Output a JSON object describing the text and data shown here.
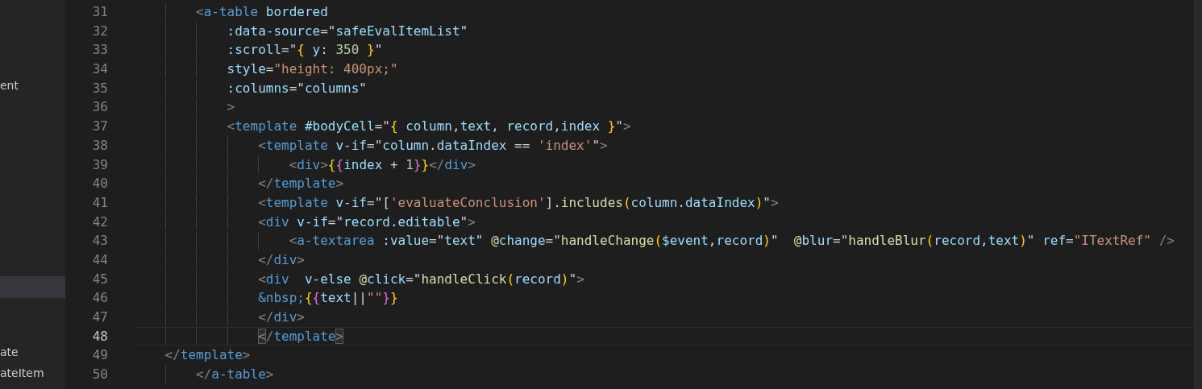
{
  "sidebar": {
    "items": [
      {
        "label": "ent",
        "selected": false
      },
      {
        "selected": true
      },
      {
        "label": "ate",
        "selected": false
      },
      {
        "label": "ateItem",
        "selected": false
      }
    ]
  },
  "editor": {
    "lines": [
      {
        "number": "31",
        "current": false,
        "tokens": [
          {
            "kind": "punct",
            "text": "        <"
          },
          {
            "kind": "tag",
            "text": "a-table"
          },
          {
            "kind": "attr",
            "text": " bordered"
          }
        ]
      },
      {
        "number": "32",
        "current": false,
        "tokens": [
          {
            "kind": "attr",
            "text": "            :data-source"
          },
          {
            "kind": "plain",
            "text": "=\""
          },
          {
            "kind": "var",
            "text": "safeEvalItemList"
          },
          {
            "kind": "plain",
            "text": "\""
          }
        ]
      },
      {
        "number": "33",
        "current": false,
        "tokens": [
          {
            "kind": "attr",
            "text": "            :scroll"
          },
          {
            "kind": "plain",
            "text": "=\""
          },
          {
            "kind": "brace1",
            "text": "{"
          },
          {
            "kind": "var",
            "text": " y"
          },
          {
            "kind": "plain",
            "text": ": "
          },
          {
            "kind": "number",
            "text": "350"
          },
          {
            "kind": "brace1",
            "text": " }"
          },
          {
            "kind": "plain",
            "text": "\""
          }
        ]
      },
      {
        "number": "34",
        "current": false,
        "tokens": [
          {
            "kind": "attr",
            "text": "            style"
          },
          {
            "kind": "plain",
            "text": "="
          },
          {
            "kind": "string",
            "text": "\"height: 400px;\""
          }
        ]
      },
      {
        "number": "35",
        "current": false,
        "tokens": [
          {
            "kind": "attr",
            "text": "            :columns"
          },
          {
            "kind": "plain",
            "text": "=\""
          },
          {
            "kind": "var",
            "text": "columns"
          },
          {
            "kind": "plain",
            "text": "\""
          }
        ]
      },
      {
        "number": "36",
        "current": false,
        "tokens": [
          {
            "kind": "punct",
            "text": "            >"
          }
        ]
      },
      {
        "number": "37",
        "current": false,
        "tokens": [
          {
            "kind": "punct",
            "text": "            <"
          },
          {
            "kind": "tag",
            "text": "template"
          },
          {
            "kind": "attr",
            "text": " #bodyCell"
          },
          {
            "kind": "plain",
            "text": "=\""
          },
          {
            "kind": "brace1",
            "text": "{"
          },
          {
            "kind": "var",
            "text": " column"
          },
          {
            "kind": "plain",
            "text": ","
          },
          {
            "kind": "var",
            "text": "text"
          },
          {
            "kind": "plain",
            "text": ", "
          },
          {
            "kind": "var",
            "text": "record"
          },
          {
            "kind": "plain",
            "text": ","
          },
          {
            "kind": "var",
            "text": "index"
          },
          {
            "kind": "brace1",
            "text": " }"
          },
          {
            "kind": "plain",
            "text": "\""
          },
          {
            "kind": "punct",
            "text": ">"
          }
        ]
      },
      {
        "number": "38",
        "current": false,
        "tokens": [
          {
            "kind": "punct",
            "text": "                <"
          },
          {
            "kind": "tag",
            "text": "template"
          },
          {
            "kind": "attr",
            "text": " v-if"
          },
          {
            "kind": "plain",
            "text": "=\""
          },
          {
            "kind": "var",
            "text": "column"
          },
          {
            "kind": "plain",
            "text": "."
          },
          {
            "kind": "var",
            "text": "dataIndex"
          },
          {
            "kind": "plain",
            "text": " == "
          },
          {
            "kind": "string",
            "text": "'index'"
          },
          {
            "kind": "plain",
            "text": "\""
          },
          {
            "kind": "punct",
            "text": ">"
          }
        ]
      },
      {
        "number": "39",
        "current": false,
        "tokens": [
          {
            "kind": "punct",
            "text": "                    <"
          },
          {
            "kind": "tag",
            "text": "div"
          },
          {
            "kind": "punct",
            "text": ">"
          },
          {
            "kind": "brace1",
            "text": "{"
          },
          {
            "kind": "brace2",
            "text": "{"
          },
          {
            "kind": "var",
            "text": "index"
          },
          {
            "kind": "plain",
            "text": " + "
          },
          {
            "kind": "number",
            "text": "1"
          },
          {
            "kind": "brace2",
            "text": "}"
          },
          {
            "kind": "brace1",
            "text": "}"
          },
          {
            "kind": "punct",
            "text": "</"
          },
          {
            "kind": "tag",
            "text": "div"
          },
          {
            "kind": "punct",
            "text": ">"
          }
        ]
      },
      {
        "number": "40",
        "current": false,
        "tokens": [
          {
            "kind": "punct",
            "text": "                </"
          },
          {
            "kind": "tag",
            "text": "template"
          },
          {
            "kind": "punct",
            "text": ">"
          }
        ]
      },
      {
        "number": "41",
        "current": false,
        "tokens": [
          {
            "kind": "punct",
            "text": "                <"
          },
          {
            "kind": "tag",
            "text": "template"
          },
          {
            "kind": "attr",
            "text": " v-if"
          },
          {
            "kind": "plain",
            "text": "=\"["
          },
          {
            "kind": "string",
            "text": "'evaluateConclusion'"
          },
          {
            "kind": "plain",
            "text": "]."
          },
          {
            "kind": "func",
            "text": "includes"
          },
          {
            "kind": "brace1",
            "text": "("
          },
          {
            "kind": "var",
            "text": "column"
          },
          {
            "kind": "plain",
            "text": "."
          },
          {
            "kind": "var",
            "text": "dataIndex"
          },
          {
            "kind": "brace1",
            "text": ")"
          },
          {
            "kind": "plain",
            "text": "\""
          },
          {
            "kind": "punct",
            "text": ">"
          }
        ]
      },
      {
        "number": "42",
        "current": false,
        "tokens": [
          {
            "kind": "punct",
            "text": "                <"
          },
          {
            "kind": "tag",
            "text": "div"
          },
          {
            "kind": "attr",
            "text": " v-if"
          },
          {
            "kind": "plain",
            "text": "=\""
          },
          {
            "kind": "var",
            "text": "record"
          },
          {
            "kind": "plain",
            "text": "."
          },
          {
            "kind": "var",
            "text": "editable"
          },
          {
            "kind": "plain",
            "text": "\""
          },
          {
            "kind": "punct",
            "text": ">"
          }
        ]
      },
      {
        "number": "43",
        "current": false,
        "tokens": [
          {
            "kind": "punct",
            "text": "                    <"
          },
          {
            "kind": "tag",
            "text": "a-textarea"
          },
          {
            "kind": "attr",
            "text": " :value"
          },
          {
            "kind": "plain",
            "text": "=\""
          },
          {
            "kind": "var",
            "text": "text"
          },
          {
            "kind": "plain",
            "text": "\" "
          },
          {
            "kind": "event",
            "text": "@change"
          },
          {
            "kind": "plain",
            "text": "=\""
          },
          {
            "kind": "func",
            "text": "handleChange"
          },
          {
            "kind": "brace1",
            "text": "("
          },
          {
            "kind": "var",
            "text": "$event"
          },
          {
            "kind": "plain",
            "text": ","
          },
          {
            "kind": "var",
            "text": "record"
          },
          {
            "kind": "brace1",
            "text": ")"
          },
          {
            "kind": "plain",
            "text": "\"  "
          },
          {
            "kind": "event",
            "text": "@blur"
          },
          {
            "kind": "plain",
            "text": "=\""
          },
          {
            "kind": "func",
            "text": "handleBlur"
          },
          {
            "kind": "brace1",
            "text": "("
          },
          {
            "kind": "var",
            "text": "record"
          },
          {
            "kind": "plain",
            "text": ","
          },
          {
            "kind": "var",
            "text": "text"
          },
          {
            "kind": "brace1",
            "text": ")"
          },
          {
            "kind": "plain",
            "text": "\" "
          },
          {
            "kind": "attr",
            "text": "ref"
          },
          {
            "kind": "plain",
            "text": "="
          },
          {
            "kind": "string",
            "text": "\"ITextRef\""
          },
          {
            "kind": "punct",
            "text": " />"
          }
        ]
      },
      {
        "number": "44",
        "current": false,
        "tokens": [
          {
            "kind": "punct",
            "text": "                </"
          },
          {
            "kind": "tag",
            "text": "div"
          },
          {
            "kind": "punct",
            "text": ">"
          }
        ]
      },
      {
        "number": "45",
        "current": false,
        "tokens": [
          {
            "kind": "punct",
            "text": "                <"
          },
          {
            "kind": "tag",
            "text": "div"
          },
          {
            "kind": "attr",
            "text": "  v-else"
          },
          {
            "kind": "event",
            "text": " @click"
          },
          {
            "kind": "plain",
            "text": "=\""
          },
          {
            "kind": "func",
            "text": "handleClick"
          },
          {
            "kind": "brace1",
            "text": "("
          },
          {
            "kind": "var",
            "text": "record"
          },
          {
            "kind": "brace1",
            "text": ")"
          },
          {
            "kind": "plain",
            "text": "\""
          },
          {
            "kind": "punct",
            "text": ">"
          }
        ]
      },
      {
        "number": "46",
        "current": false,
        "tokens": [
          {
            "kind": "entity",
            "text": "                &nbsp;"
          },
          {
            "kind": "brace1",
            "text": "{"
          },
          {
            "kind": "brace2",
            "text": "{"
          },
          {
            "kind": "var",
            "text": "text"
          },
          {
            "kind": "plain",
            "text": "||"
          },
          {
            "kind": "string",
            "text": "\"\""
          },
          {
            "kind": "brace2",
            "text": "}"
          },
          {
            "kind": "brace1",
            "text": "}"
          }
        ]
      },
      {
        "number": "47",
        "current": false,
        "tokens": [
          {
            "kind": "punct",
            "text": "                </"
          },
          {
            "kind": "tag",
            "text": "div"
          },
          {
            "kind": "punct",
            "text": ">"
          }
        ]
      },
      {
        "number": "48",
        "current": true,
        "tokens": [
          {
            "kind": "match",
            "text": "                <"
          },
          {
            "kind": "punct",
            "text": "/"
          },
          {
            "kind": "tag",
            "text": "template"
          },
          {
            "kind": "match",
            "text": ">"
          }
        ]
      },
      {
        "number": "49",
        "current": false,
        "tokens": [
          {
            "kind": "punct",
            "text": "    </"
          },
          {
            "kind": "tag",
            "text": "template"
          },
          {
            "kind": "punct",
            "text": ">"
          }
        ]
      },
      {
        "number": "50",
        "current": false,
        "tokens": [
          {
            "kind": "punct",
            "text": "        </"
          },
          {
            "kind": "tag",
            "text": "a-table"
          },
          {
            "kind": "punct",
            "text": ">"
          }
        ]
      }
    ]
  }
}
